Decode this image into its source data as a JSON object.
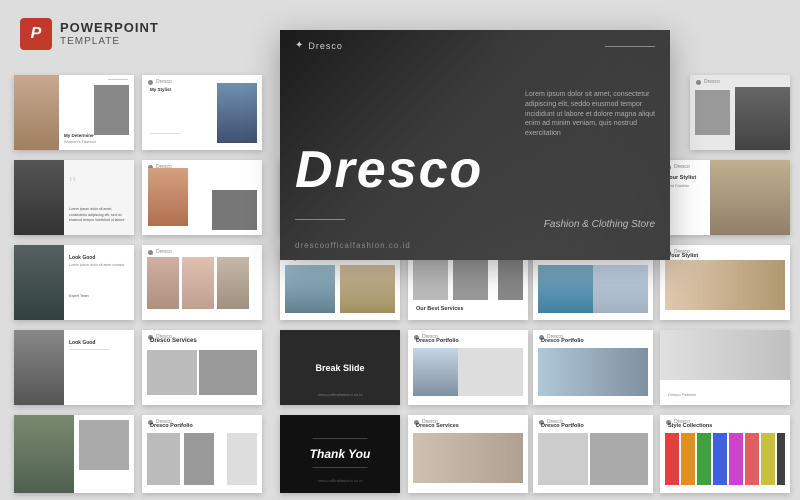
{
  "app": {
    "title": "PowerPoint Template",
    "brand": "POWERPOINT",
    "sub": "TEMPLATE"
  },
  "hero": {
    "brand": "Dresco",
    "title": "Dresco",
    "description": "Lorem ipsum dolor sit amet, consectetur adipiscing elit, seddo eiusmod tempor incididunt ut labore et dolore magna aliqut enim ad minim veniam, quis nostrud exercitation",
    "subtitle": "Fashion & Clothing Store",
    "url": "drescoofficalfashion.co.id"
  },
  "slides": {
    "break_label": "Break Slide",
    "thank_you_label": "Thank You"
  }
}
